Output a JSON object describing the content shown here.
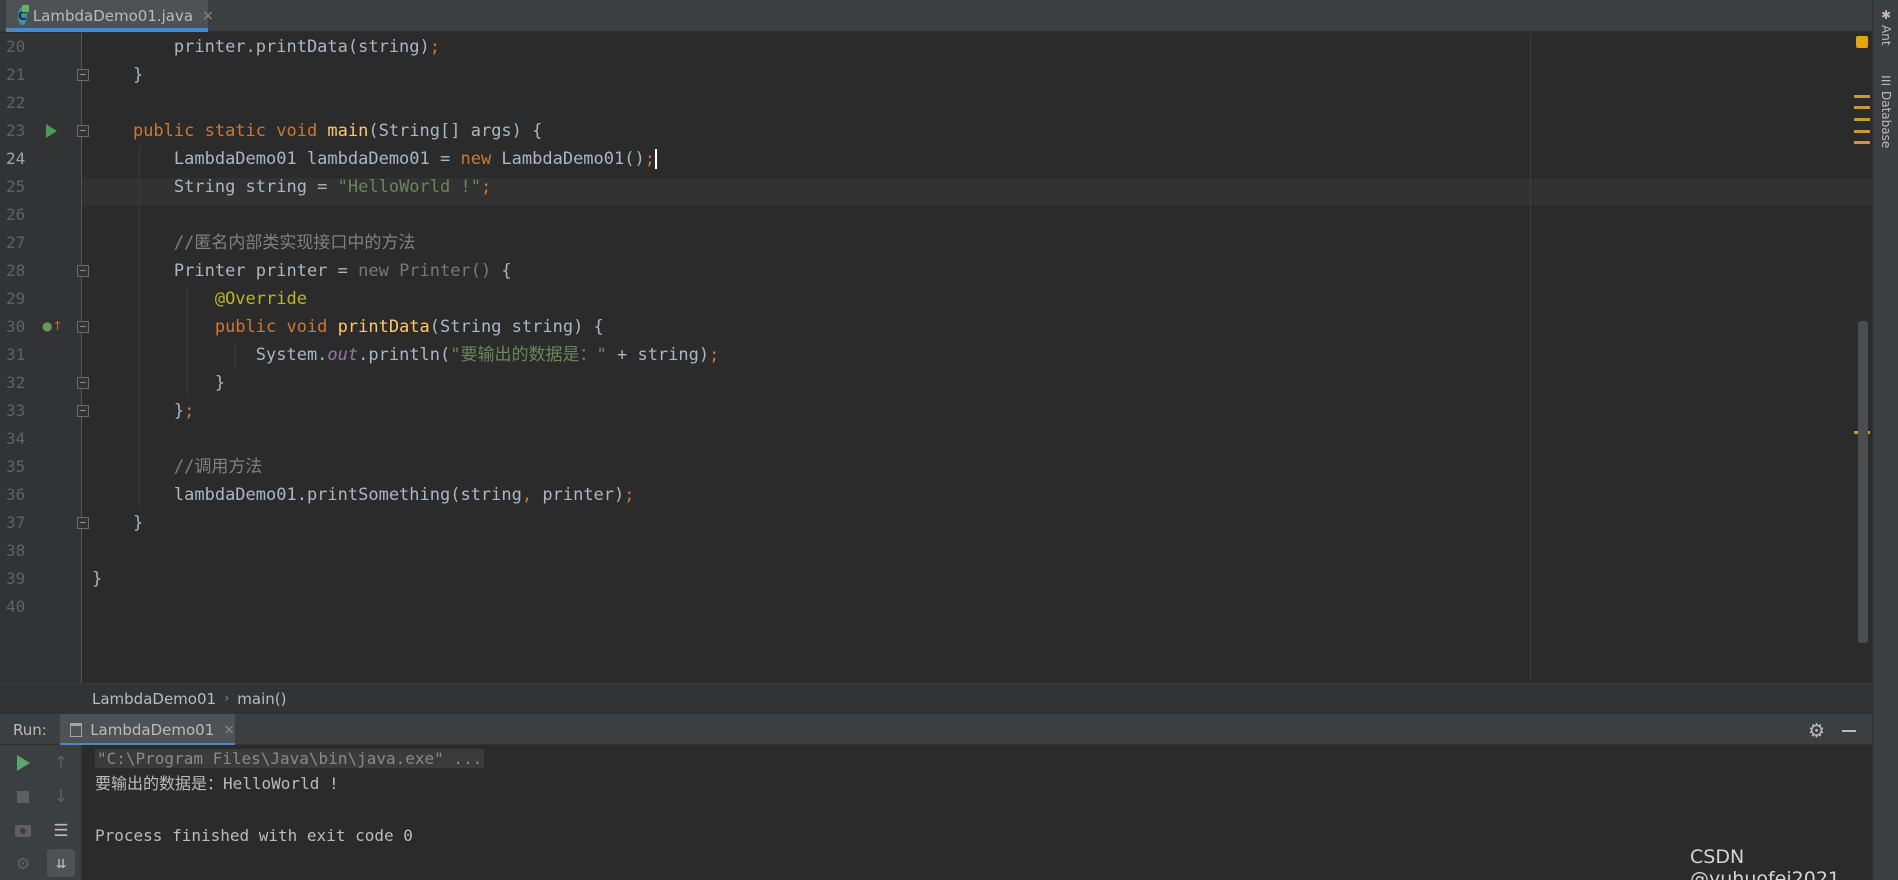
{
  "editor_tab": {
    "label": "LambdaDemo01.java",
    "close": "×",
    "icon": "class-icon"
  },
  "tool_windows": [
    {
      "label": "Ant",
      "icon": "ant-icon"
    },
    {
      "label": "Database",
      "icon": "database-icon"
    }
  ],
  "code": {
    "current_line": 24,
    "line_numbers": [
      "20",
      "21",
      "22",
      "23",
      "24",
      "25",
      "26",
      "27",
      "28",
      "29",
      "30",
      "31",
      "32",
      "33",
      "34",
      "35",
      "36",
      "37",
      "38",
      "39",
      "40"
    ],
    "lines": [
      {
        "indent": "        ",
        "tokens": [
          {
            "t": "printer.printData(string)"
          },
          {
            "t": ";",
            "c": "kw"
          }
        ]
      },
      {
        "indent": "    ",
        "tokens": [
          {
            "t": "}"
          }
        ]
      },
      {
        "indent": "",
        "tokens": []
      },
      {
        "indent": "    ",
        "tokens": [
          {
            "t": "public static void ",
            "c": "kw"
          },
          {
            "t": "main",
            "c": "fn"
          },
          {
            "t": "(String[] args) {"
          }
        ]
      },
      {
        "indent": "        ",
        "tokens": [
          {
            "t": "LambdaDemo01 lambdaDemo01 = "
          },
          {
            "t": "new ",
            "c": "kw"
          },
          {
            "t": "LambdaDemo01()"
          },
          {
            "t": ";",
            "c": "kw"
          }
        ]
      },
      {
        "indent": "        ",
        "tokens": [
          {
            "t": "String string = "
          },
          {
            "t": "\"HelloWorld !\"",
            "c": "str"
          },
          {
            "t": ";",
            "c": "kw"
          }
        ]
      },
      {
        "indent": "",
        "tokens": []
      },
      {
        "indent": "        ",
        "tokens": [
          {
            "t": "//匿名内部类实现接口中的方法",
            "c": "cmt"
          }
        ]
      },
      {
        "indent": "        ",
        "tokens": [
          {
            "t": "Printer printer = "
          },
          {
            "t": "new Printer() ",
            "c": "dim"
          },
          {
            "t": "{"
          }
        ]
      },
      {
        "indent": "            ",
        "tokens": [
          {
            "t": "@Override",
            "c": "ann"
          }
        ]
      },
      {
        "indent": "            ",
        "tokens": [
          {
            "t": "public void ",
            "c": "kw"
          },
          {
            "t": "printData",
            "c": "fn"
          },
          {
            "t": "(String string) {"
          }
        ]
      },
      {
        "indent": "                ",
        "tokens": [
          {
            "t": "System."
          },
          {
            "t": "out",
            "c": "static"
          },
          {
            "t": ".println("
          },
          {
            "t": "\"要输出的数据是：\"",
            "c": "str"
          },
          {
            "t": " + string)"
          },
          {
            "t": ";",
            "c": "kw"
          }
        ]
      },
      {
        "indent": "            ",
        "tokens": [
          {
            "t": "}"
          }
        ]
      },
      {
        "indent": "        ",
        "tokens": [
          {
            "t": "}"
          },
          {
            "t": ";",
            "c": "kw"
          }
        ]
      },
      {
        "indent": "",
        "tokens": []
      },
      {
        "indent": "        ",
        "tokens": [
          {
            "t": "//调用方法",
            "c": "cmt"
          }
        ]
      },
      {
        "indent": "        ",
        "tokens": [
          {
            "t": "lambdaDemo01.printSomething(string"
          },
          {
            "t": ",",
            "c": "kw"
          },
          {
            "t": " printer)"
          },
          {
            "t": ";",
            "c": "kw"
          }
        ]
      },
      {
        "indent": "    ",
        "tokens": [
          {
            "t": "}"
          }
        ]
      },
      {
        "indent": "",
        "tokens": []
      },
      {
        "indent": "",
        "tokens": [
          {
            "t": "}"
          }
        ]
      },
      {
        "indent": "",
        "tokens": []
      }
    ]
  },
  "breadcrumb": {
    "class_name": "LambdaDemo01",
    "separator": "›",
    "method_name": "main()"
  },
  "run_panel": {
    "label": "Run:",
    "tab_label": "LambdaDemo01",
    "tab_close": "×",
    "console": [
      "\"C:\\Program Files\\Java\\bin\\java.exe\" ...",
      "要输出的数据是：HelloWorld !",
      "",
      "Process finished with exit code 0"
    ]
  },
  "watermark": "CSDN @yuhuofei2021",
  "colors": {
    "keyword": "#cc7832",
    "function": "#ffc66d",
    "string": "#6a8759",
    "comment": "#808080",
    "annotation": "#bbb529",
    "static_field": "#9876aa",
    "accent": "#4a88c7"
  }
}
